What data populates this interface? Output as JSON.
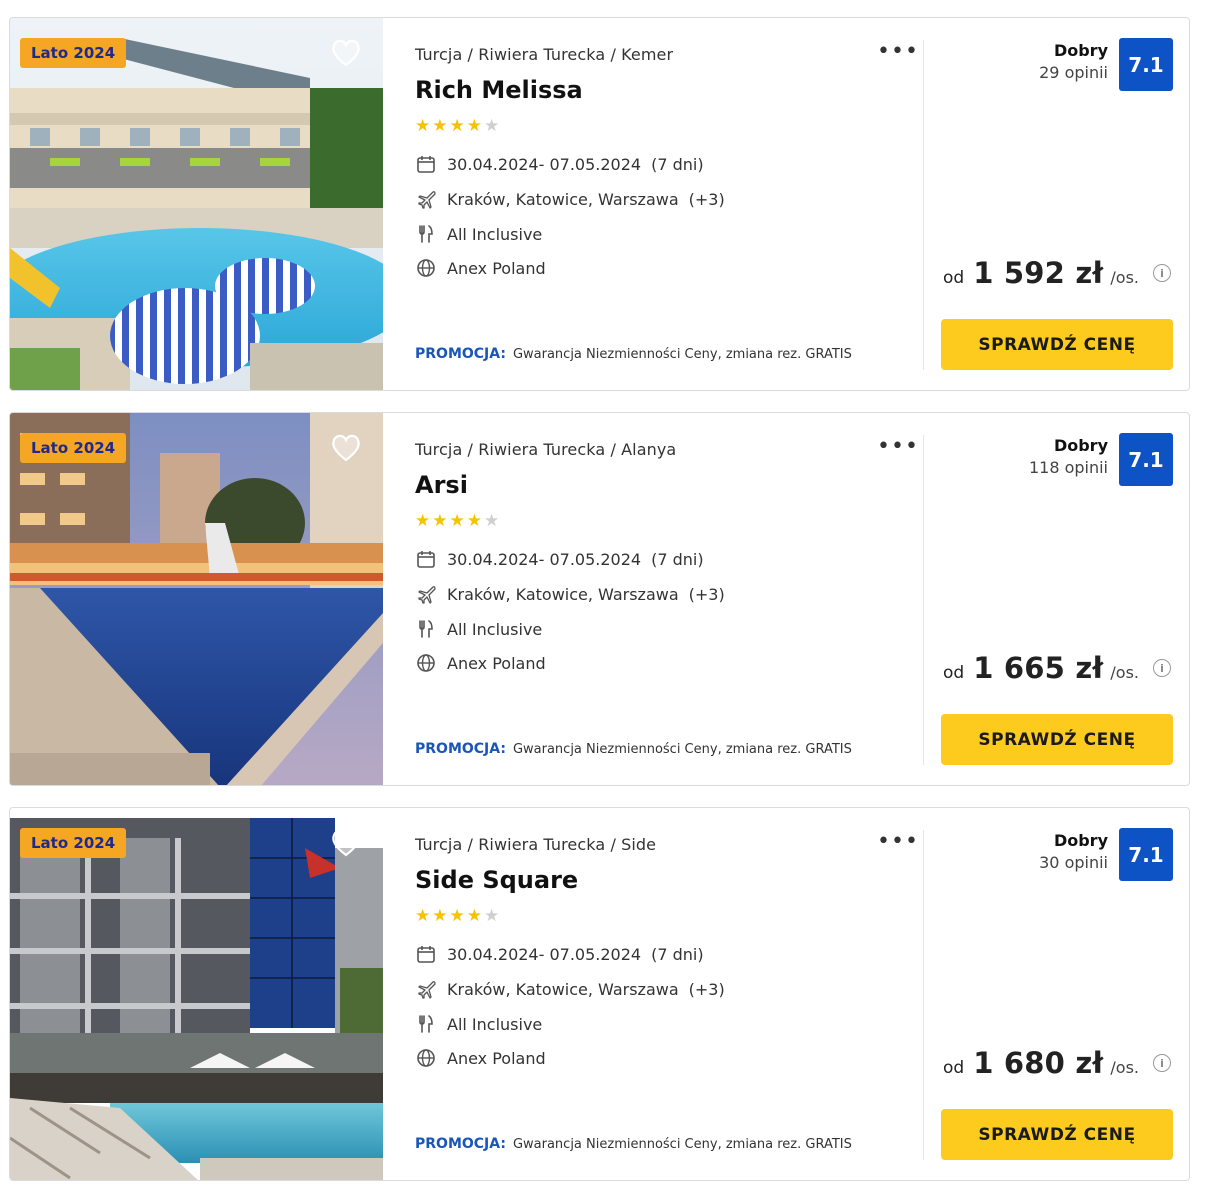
{
  "common": {
    "promo_label": "PROMOCJA:",
    "price_prefix": "od",
    "price_suffix": "/os.",
    "cta_label": "SPRAWDŹ CENĘ",
    "more_icon": "more-horizontal-icon",
    "info_icon": "info-icon"
  },
  "colors": {
    "badge_bg": "#f5a623",
    "score_bg": "#0d53c6",
    "cta_bg": "#fdcb1e",
    "promo": "#1a56b8",
    "star": "#f5c400"
  },
  "offers": [
    {
      "badge": "Lato 2024",
      "breadcrumb": "Turcja / Riwiera Turecka / Kemer",
      "name": "Rich Melissa",
      "stars_full": 4,
      "stars_total": 5,
      "dates": "30.04.2024- 07.05.2024",
      "duration": "(7 dni)",
      "departure": "Kraków, Katowice, Warszawa",
      "departure_more": "(+3)",
      "board": "All Inclusive",
      "operator": "Anex Poland",
      "promo_text": "Gwarancja Niezmienności Ceny, zmiana rez. GRATIS",
      "rating_label": "Dobry",
      "rating_count": "29 opinii",
      "score": "7.1",
      "price": "1 592 zł"
    },
    {
      "badge": "Lato 2024",
      "breadcrumb": "Turcja / Riwiera Turecka / Alanya",
      "name": "Arsi",
      "stars_full": 4,
      "stars_total": 5,
      "dates": "30.04.2024- 07.05.2024",
      "duration": "(7 dni)",
      "departure": "Kraków, Katowice, Warszawa",
      "departure_more": "(+3)",
      "board": "All Inclusive",
      "operator": "Anex Poland",
      "promo_text": "Gwarancja Niezmienności Ceny, zmiana rez. GRATIS",
      "rating_label": "Dobry",
      "rating_count": "118 opinii",
      "score": "7.1",
      "price": "1 665 zł"
    },
    {
      "badge": "Lato 2024",
      "breadcrumb": "Turcja / Riwiera Turecka / Side",
      "name": "Side Square",
      "stars_full": 4,
      "stars_total": 5,
      "dates": "30.04.2024- 07.05.2024",
      "duration": "(7 dni)",
      "departure": "Kraków, Katowice, Warszawa",
      "departure_more": "(+3)",
      "board": "All Inclusive",
      "operator": "Anex Poland",
      "promo_text": "Gwarancja Niezmienności Ceny, zmiana rez. GRATIS",
      "rating_label": "Dobry",
      "rating_count": "30 opinii",
      "score": "7.1",
      "price": "1 680 zł"
    }
  ]
}
